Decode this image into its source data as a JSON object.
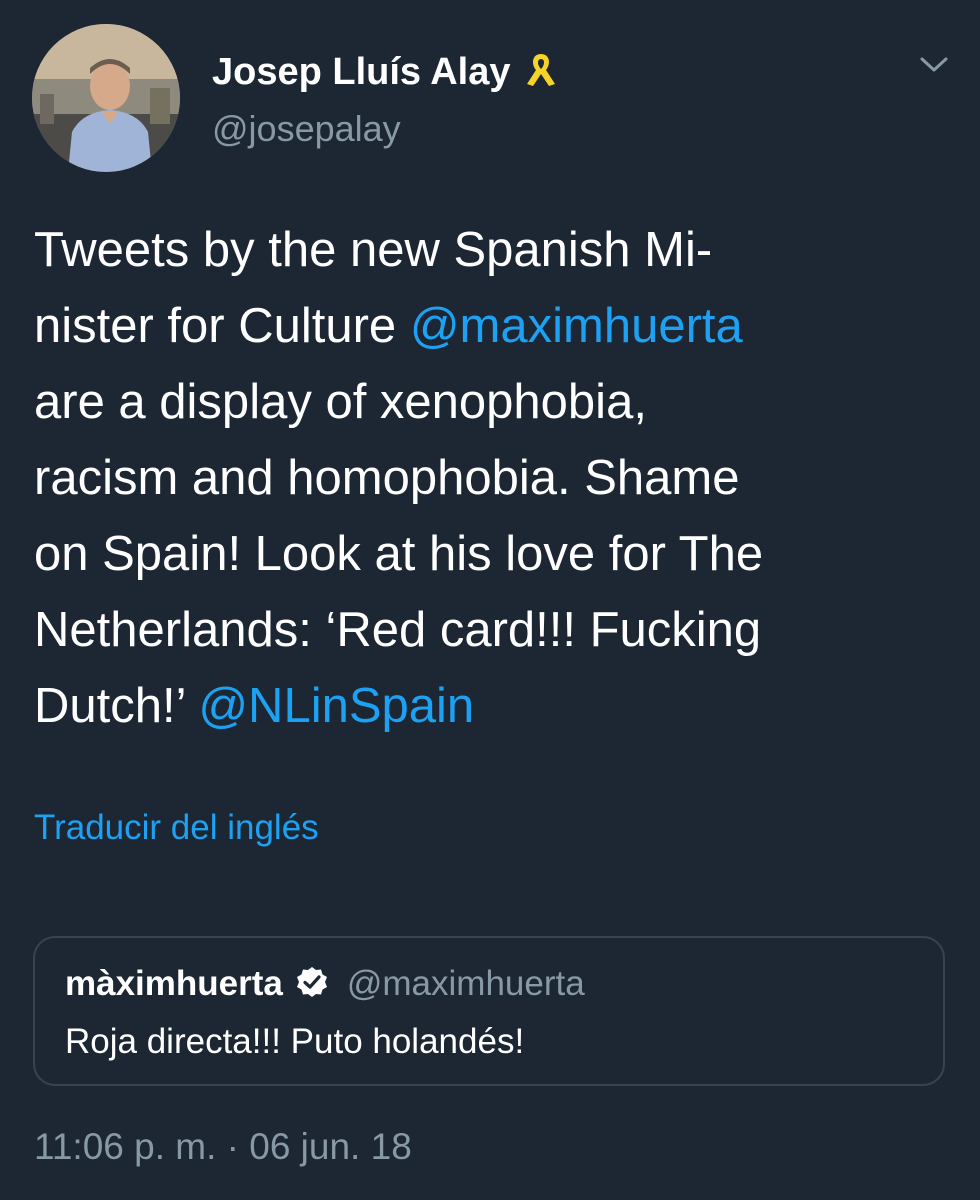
{
  "tweet": {
    "author": {
      "display_name": "Josep Lluís Alay",
      "handle": "@josepalay",
      "badge_icon": "yellow-ribbon-icon"
    },
    "text_lines": [
      [
        {
          "t": "Tweets by the new Spanish Mi-"
        }
      ],
      [
        {
          "t": "nister for Culture "
        },
        {
          "t": "@maximhuerta",
          "mention": true
        }
      ],
      [
        {
          "t": "are a display of xenophobia,"
        }
      ],
      [
        {
          "t": "racism and homophobia. Shame"
        }
      ],
      [
        {
          "t": "on Spain! Look at his love for The"
        }
      ],
      [
        {
          "t": "Netherlands: ‘Red card!!! Fucking"
        }
      ],
      [
        {
          "t": "Dutch!’ "
        },
        {
          "t": "@NLinSpain",
          "mention": true
        }
      ]
    ],
    "translate_label": "Traducir del inglés",
    "quoted": {
      "display_name": "màximhuerta",
      "verified_icon": "verified-badge-icon",
      "handle": "@maximhuerta",
      "text": "Roja directa!!! Puto holandés!"
    },
    "timestamp": "11:06 p. m. · 06 jun. 18"
  },
  "colors": {
    "background": "#1c2733",
    "text": "#ffffff",
    "secondary": "#8899a6",
    "accent": "#1da1f2",
    "ribbon": "#f5d327",
    "border": "#38444d"
  }
}
